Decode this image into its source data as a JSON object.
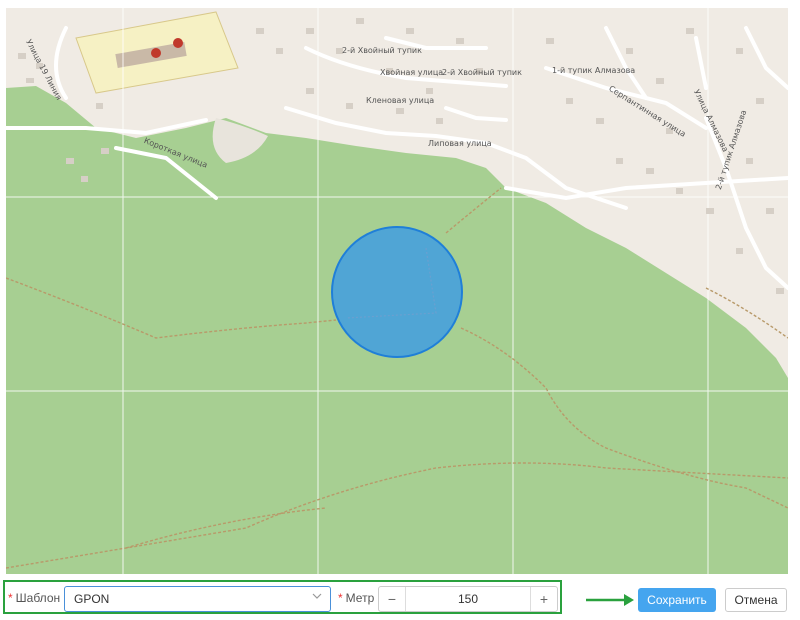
{
  "map": {
    "streets": [
      "Улица 19 Линия",
      "Короткая улица",
      "2-й Хвойный тупик",
      "Хвойная улица",
      "2-й Хвойный тупик",
      "Кленовая улица",
      "Липовая улица",
      "1-й тупик Алмазова",
      "Серпантинная улица",
      "Улица Алмазова",
      "2-й тупик Алмазова"
    ]
  },
  "form": {
    "template_label": "Шаблон",
    "template_value": "GPON",
    "meter_label": "Метр",
    "meter_value": "150",
    "required_mark": "*",
    "minus": "−",
    "plus": "+"
  },
  "actions": {
    "save_label": "Сохранить",
    "cancel_label": "Отмена"
  },
  "colors": {
    "forest": "#a7cf92",
    "land": "#f0ebe4",
    "circle_fill": "#3b9ae6",
    "highlight": "#2aa13e",
    "save_bg": "#45a5ef"
  }
}
